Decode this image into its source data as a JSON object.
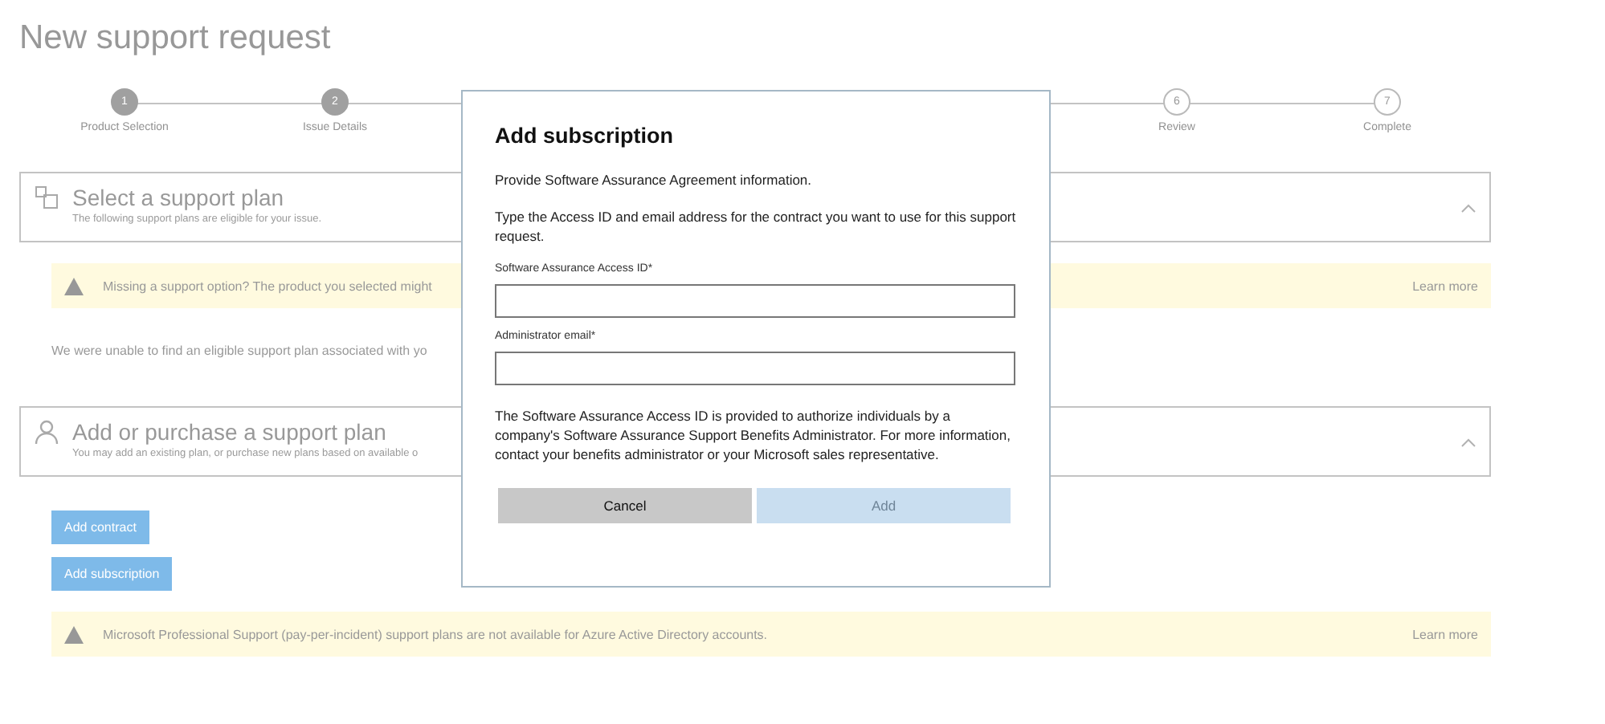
{
  "page": {
    "title": "New support request",
    "steps": [
      {
        "number": "1",
        "label": "Product Selection",
        "completed": true
      },
      {
        "number": "2",
        "label": "Issue Details",
        "completed": true
      },
      {
        "number": "6",
        "label": "Review",
        "completed": false
      },
      {
        "number": "7",
        "label": "Complete",
        "completed": false
      }
    ],
    "plan_section": {
      "title": "Select a support plan",
      "subtitle": "The following support plans are eligible for your issue."
    },
    "plan_warning": {
      "text": "Missing a support option? The product you selected might",
      "link": "Learn more"
    },
    "plan_message": "We were unable to find an eligible support plan associated with yo",
    "purchase_section": {
      "title": "Add or purchase a support plan",
      "subtitle": "You may add an existing plan, or purchase new plans based on available o"
    },
    "buttons": [
      "Add contract",
      "Add subscription"
    ],
    "purchase_warning": {
      "text": "Microsoft Professional Support (pay-per-incident) support plans are not available for Azure Active Directory accounts.",
      "link": "Learn more"
    }
  },
  "dialog": {
    "title": "Add subscription",
    "intro": "Provide Software Assurance Agreement information.",
    "instructions": "Type the Access ID and email address for the contract you want to use for this support request.",
    "fields": [
      {
        "label": "Software Assurance Access ID*"
      },
      {
        "label": "Administrator email*"
      }
    ],
    "note": "The Software Assurance Access ID is provided to authorize individuals by a company's Software Assurance Support Benefits Administrator. For more information, contact your benefits administrator or your Microsoft sales representative.",
    "buttons": [
      {
        "label": "Cancel",
        "disabled": false
      },
      {
        "label": "Add",
        "disabled": true
      }
    ]
  }
}
